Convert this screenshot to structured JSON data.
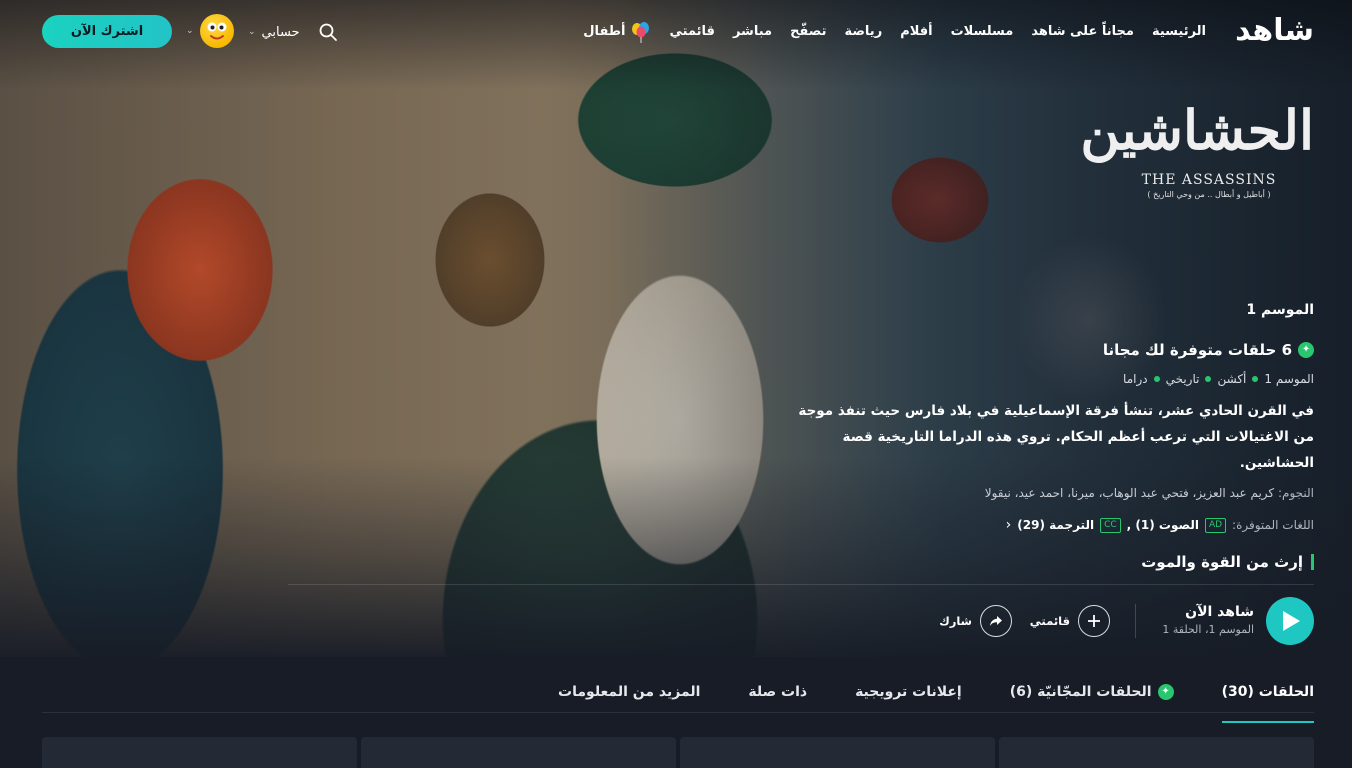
{
  "nav": {
    "logo": "شاهد",
    "links": [
      "الرئيسية",
      "مجاناً على شاهد",
      "مسلسلات",
      "أفلام",
      "رياضة",
      "تصفّح",
      "مباشر",
      "قائمتي"
    ],
    "kids_label": "أطفال",
    "account_label": "حسابي",
    "subscribe_label": "اشترك الآن",
    "icons": {
      "search": "search-icon",
      "avatar": "emoji-avatar",
      "kids": "balloons-icon"
    }
  },
  "show": {
    "logo_ar": "الحشاشين",
    "logo_en": "THE ASSASSINS",
    "logo_tagline": "( أباطيل و أبطال .. من وحي التاريخ )",
    "season_label": "الموسم 1",
    "free_episodes": "6 حلقات متوفرة لك مجانا",
    "meta": [
      "الموسم 1",
      "أكشن",
      "تاريخي",
      "دراما"
    ],
    "description": "في القرن الحادي عشر، تنشأ فرقة الإسماعيلية في بلاد فارس حيث تنفذ موجة من الاغتيالات التي ترعب أعظم الحكام. تروي هذه الدراما التاريخية قصة الحشاشين.",
    "cast_label": "النجوم:",
    "cast": "كريم عبد العزيز، فتحي عبد الوهاب، ميرنا، احمد عيد، نيقولا",
    "languages_label": "اللغات المتوفرة:",
    "audio_label": "الصوت (1) ,",
    "audio_tag": "AD",
    "subtitles_label": "الترجمة (29)",
    "subtitles_tag": "CC",
    "tagline": "إرث من القوة والموت"
  },
  "actions": {
    "watch_title": "شاهد الآن",
    "watch_sub": "الموسم 1، الحلقة 1",
    "mylist_label": "قائمتي",
    "share_label": "شارك"
  },
  "tabs": {
    "items": [
      "الحلقات (30)",
      "الحلقات المجّانيّة (6)",
      "إعلانات ترويجية",
      "ذات صلة",
      "المزيد من المعلومات"
    ],
    "active": 0
  },
  "colors": {
    "accent": "#1fc7c3",
    "green": "#28c76f",
    "background": "#171c26"
  }
}
